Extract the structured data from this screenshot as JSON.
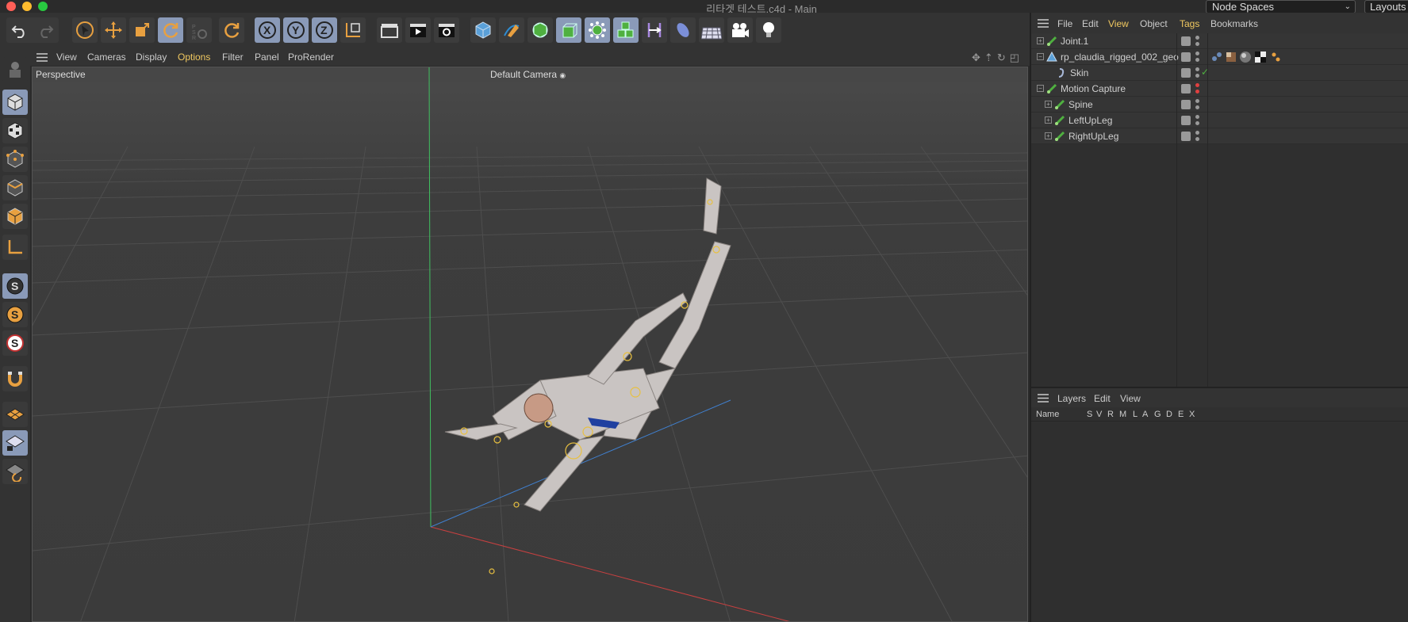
{
  "window": {
    "title": "리타겟 테스트.c4d - Main",
    "node_spaces": "Node Spaces",
    "layouts": "Layouts"
  },
  "viewport": {
    "menu": [
      "View",
      "Cameras",
      "Display",
      "Options",
      "Filter",
      "Panel",
      "ProRender"
    ],
    "active_menu": "Options",
    "projection": "Perspective",
    "camera": "Default Camera"
  },
  "object_manager": {
    "menu": [
      "File",
      "Edit",
      "View",
      "Object",
      "Tags",
      "Bookmarks"
    ],
    "objects": [
      {
        "name": "Joint.1",
        "indent": 0,
        "type": "joint",
        "dot": "grey"
      },
      {
        "name": "rp_claudia_rigged_002_geo",
        "indent": 0,
        "type": "mesh",
        "dot": "grey"
      },
      {
        "name": "Skin",
        "indent": 1,
        "type": "skin",
        "dot": "grey",
        "check": true
      },
      {
        "name": "Motion Capture",
        "indent": 0,
        "type": "joint",
        "dot": "red"
      },
      {
        "name": "Spine",
        "indent": 1,
        "type": "joint",
        "dot": "grey"
      },
      {
        "name": "LeftUpLeg",
        "indent": 1,
        "type": "joint",
        "dot": "grey"
      },
      {
        "name": "RightUpLeg",
        "indent": 1,
        "type": "joint",
        "dot": "grey"
      }
    ]
  },
  "layers": {
    "menu": [
      "Layers",
      "Edit",
      "View"
    ],
    "columns": [
      "Name",
      "S",
      "V",
      "R",
      "M",
      "L",
      "A",
      "G",
      "D",
      "E",
      "X"
    ]
  },
  "colors": {
    "accent_menu": "#f0c860",
    "selected_button": "#8a9ab8",
    "x_axis": "#c84040",
    "y_axis": "#40c060",
    "z_axis": "#4080d0"
  }
}
